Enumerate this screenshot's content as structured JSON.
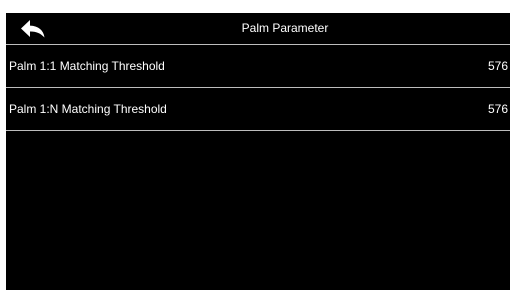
{
  "header": {
    "title": "Palm Parameter",
    "back_icon": "back-arrow-icon"
  },
  "settings": [
    {
      "label": "Palm 1:1 Matching Threshold",
      "value": "576"
    },
    {
      "label": "Palm 1:N Matching Threshold",
      "value": "576"
    }
  ],
  "colors": {
    "background": "#000000",
    "text": "#ffffff",
    "divider": "#bdbdbd"
  }
}
